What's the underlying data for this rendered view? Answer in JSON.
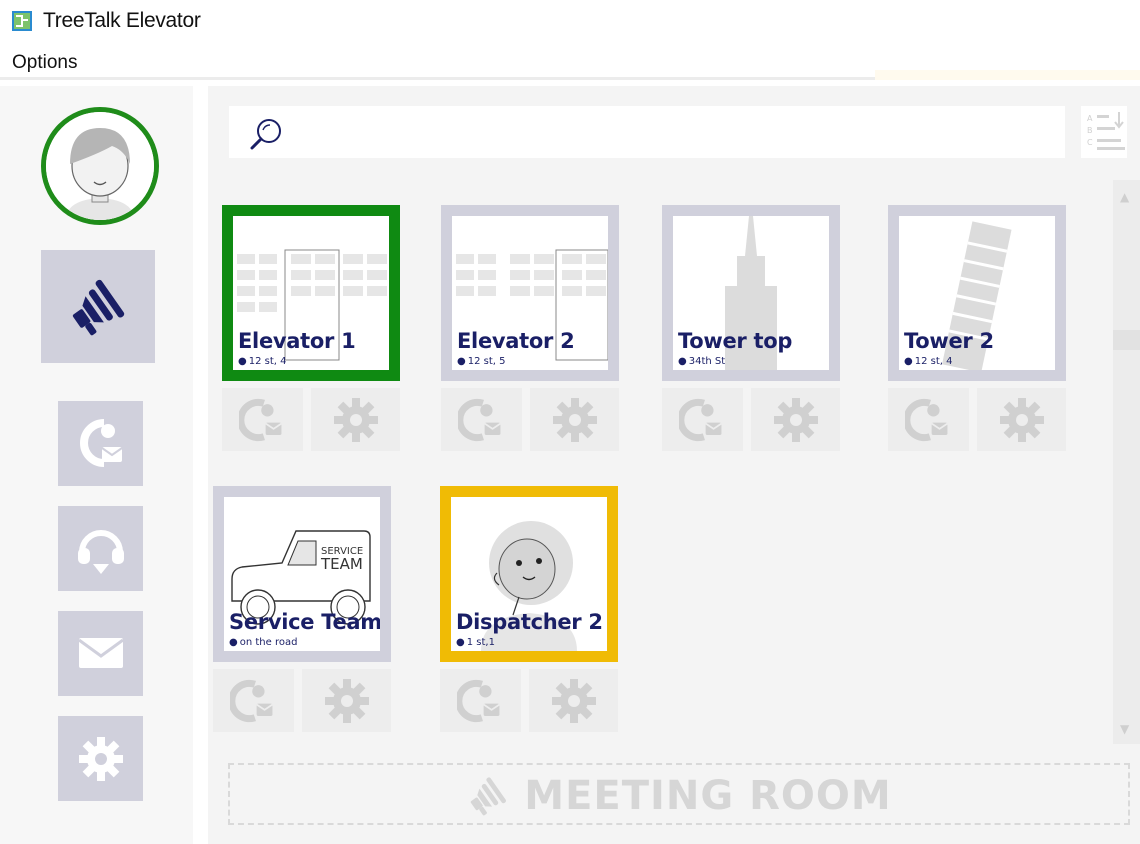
{
  "window": {
    "title": "TreeTalk Elevator"
  },
  "menu": {
    "options_label": "Options"
  },
  "search": {
    "placeholder": ""
  },
  "tiles": [
    {
      "name": "Elevator 1",
      "location": "12 st, 4",
      "status": "green"
    },
    {
      "name": "Elevator 2",
      "location": "12 st, 5",
      "status": "none"
    },
    {
      "name": "Tower top",
      "location": "34th St",
      "status": "none"
    },
    {
      "name": "Tower 2",
      "location": "12 st, 4",
      "status": "none"
    },
    {
      "name": "Service Team",
      "location": "on the road",
      "status": "none",
      "image_text": [
        "SERVICE",
        "TEAM"
      ]
    },
    {
      "name": "Dispatcher 2",
      "location": "1 st,1",
      "status": "yellow"
    }
  ],
  "meeting_room": {
    "label": "MEETING ROOM"
  },
  "sidebar": {
    "items": [
      {
        "icon": "megaphone-icon"
      },
      {
        "icon": "call-message-icon"
      },
      {
        "icon": "headset-icon"
      },
      {
        "icon": "envelope-icon"
      },
      {
        "icon": "gear-icon"
      }
    ]
  },
  "colors": {
    "online": "#0f8a12",
    "busy": "#f0bb05",
    "tile_border": "#d0d0dc",
    "accent_text": "#1a1f66"
  }
}
